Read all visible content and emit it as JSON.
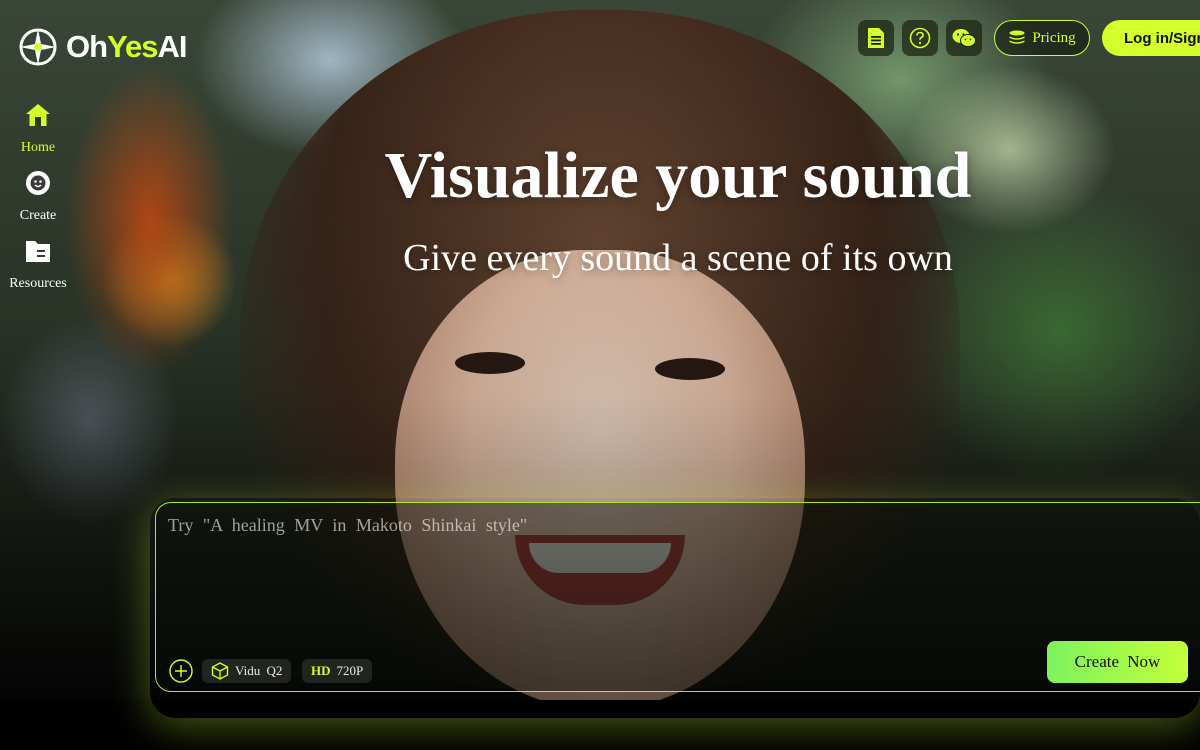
{
  "brand": {
    "name_part1": "Oh",
    "name_part2": "Yes",
    "name_part3": "AI",
    "accent_color": "#d4ff2a"
  },
  "header": {
    "icons": [
      "document-icon",
      "help-icon",
      "wechat-icon"
    ],
    "pricing_label": "Pricing",
    "login_label": "Log in/Sign up"
  },
  "sidebar": {
    "items": [
      {
        "label": "Home",
        "icon": "home-icon",
        "active": true
      },
      {
        "label": "Create",
        "icon": "create-icon",
        "active": false
      },
      {
        "label": "Resources",
        "icon": "folder-icon",
        "active": false
      }
    ]
  },
  "hero": {
    "title": "Visualize your sound",
    "subtitle": "Give every sound a scene of its own"
  },
  "prompt": {
    "placeholder": "Try \"A healing MV in Makoto Shinkai style\"",
    "model_label": "Vidu Q2",
    "resolution_badge": "HD",
    "resolution_label": "720P",
    "create_label": "Create Now"
  }
}
